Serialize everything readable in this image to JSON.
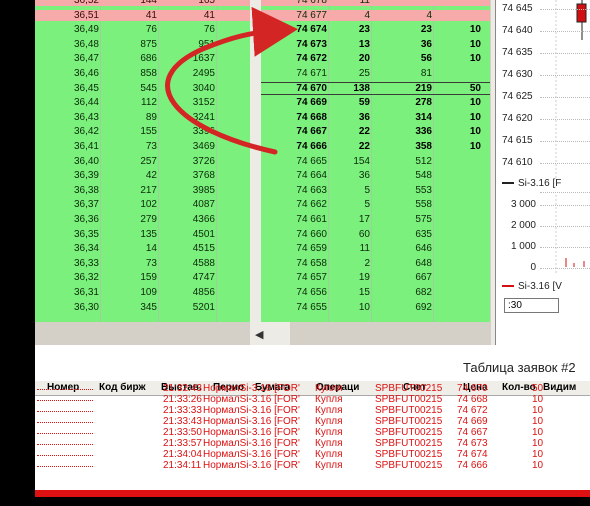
{
  "left_book": {
    "rows": [
      {
        "c0": "36,52",
        "c1": "144",
        "c2": "165",
        "color": "red"
      },
      {
        "c0": "36,51",
        "c1": "41",
        "c2": "41",
        "color": "red"
      },
      {
        "c0": "36,49",
        "c1": "76",
        "c2": "76",
        "color": "green"
      },
      {
        "c0": "36,48",
        "c1": "875",
        "c2": "951",
        "color": "green"
      },
      {
        "c0": "36,47",
        "c1": "686",
        "c2": "1637",
        "color": "green"
      },
      {
        "c0": "36,46",
        "c1": "858",
        "c2": "2495",
        "color": "green"
      },
      {
        "c0": "36,45",
        "c1": "545",
        "c2": "3040",
        "color": "green"
      },
      {
        "c0": "36,44",
        "c1": "112",
        "c2": "3152",
        "color": "green"
      },
      {
        "c0": "36,43",
        "c1": "89",
        "c2": "3241",
        "color": "green"
      },
      {
        "c0": "36,42",
        "c1": "155",
        "c2": "3396",
        "color": "green"
      },
      {
        "c0": "36,41",
        "c1": "73",
        "c2": "3469",
        "color": "green"
      },
      {
        "c0": "36,40",
        "c1": "257",
        "c2": "3726",
        "color": "green"
      },
      {
        "c0": "36,39",
        "c1": "42",
        "c2": "3768",
        "color": "green"
      },
      {
        "c0": "36,38",
        "c1": "217",
        "c2": "3985",
        "color": "green"
      },
      {
        "c0": "36,37",
        "c1": "102",
        "c2": "4087",
        "color": "green"
      },
      {
        "c0": "36,36",
        "c1": "279",
        "c2": "4366",
        "color": "green"
      },
      {
        "c0": "36,35",
        "c1": "135",
        "c2": "4501",
        "color": "green"
      },
      {
        "c0": "36,34",
        "c1": "14",
        "c2": "4515",
        "color": "green"
      },
      {
        "c0": "36,33",
        "c1": "73",
        "c2": "4588",
        "color": "green"
      },
      {
        "c0": "36,32",
        "c1": "159",
        "c2": "4747",
        "color": "green"
      },
      {
        "c0": "36,31",
        "c1": "109",
        "c2": "4856",
        "color": "green"
      },
      {
        "c0": "36,30",
        "c1": "345",
        "c2": "5201",
        "color": "green"
      }
    ]
  },
  "right_book": {
    "rows": [
      {
        "c0": "74 678",
        "c1": "11",
        "c2": "",
        "c3": "",
        "color": "red",
        "bold": false
      },
      {
        "c0": "74 677",
        "c1": "4",
        "c2": "4",
        "c3": "",
        "color": "red",
        "bold": false
      },
      {
        "c0": "74 674",
        "c1": "23",
        "c2": "23",
        "c3": "10",
        "color": "green",
        "bold": true
      },
      {
        "c0": "74 673",
        "c1": "13",
        "c2": "36",
        "c3": "10",
        "color": "green",
        "bold": true
      },
      {
        "c0": "74 672",
        "c1": "20",
        "c2": "56",
        "c3": "10",
        "color": "green",
        "bold": true
      },
      {
        "c0": "74 671",
        "c1": "25",
        "c2": "81",
        "c3": "",
        "color": "green",
        "bold": false
      },
      {
        "c0": "74 670",
        "c1": "138",
        "c2": "219",
        "c3": "50",
        "color": "green",
        "bold": true,
        "highlight": true
      },
      {
        "c0": "74 669",
        "c1": "59",
        "c2": "278",
        "c3": "10",
        "color": "green",
        "bold": true
      },
      {
        "c0": "74 668",
        "c1": "36",
        "c2": "314",
        "c3": "10",
        "color": "green",
        "bold": true
      },
      {
        "c0": "74 667",
        "c1": "22",
        "c2": "336",
        "c3": "10",
        "color": "green",
        "bold": true
      },
      {
        "c0": "74 666",
        "c1": "22",
        "c2": "358",
        "c3": "10",
        "color": "green",
        "bold": true
      },
      {
        "c0": "74 665",
        "c1": "154",
        "c2": "512",
        "c3": "",
        "color": "green",
        "bold": false
      },
      {
        "c0": "74 664",
        "c1": "36",
        "c2": "548",
        "c3": "",
        "color": "green",
        "bold": false
      },
      {
        "c0": "74 663",
        "c1": "5",
        "c2": "553",
        "c3": "",
        "color": "green",
        "bold": false
      },
      {
        "c0": "74 662",
        "c1": "5",
        "c2": "558",
        "c3": "",
        "color": "green",
        "bold": false
      },
      {
        "c0": "74 661",
        "c1": "17",
        "c2": "575",
        "c3": "",
        "color": "green",
        "bold": false
      },
      {
        "c0": "74 660",
        "c1": "60",
        "c2": "635",
        "c3": "",
        "color": "green",
        "bold": false
      },
      {
        "c0": "74 659",
        "c1": "11",
        "c2": "646",
        "c3": "",
        "color": "green",
        "bold": false
      },
      {
        "c0": "74 658",
        "c1": "2",
        "c2": "648",
        "c3": "",
        "color": "green",
        "bold": false
      },
      {
        "c0": "74 657",
        "c1": "19",
        "c2": "667",
        "c3": "",
        "color": "green",
        "bold": false
      },
      {
        "c0": "74 656",
        "c1": "15",
        "c2": "682",
        "c3": "",
        "color": "green",
        "bold": false
      },
      {
        "c0": "74 655",
        "c1": "10",
        "c2": "692",
        "c3": "",
        "color": "green",
        "bold": false
      }
    ]
  },
  "chart": {
    "price_ticks": [
      "74 645",
      "74 640",
      "74 635",
      "74 630",
      "74 625",
      "74 620",
      "74 615",
      "74 610"
    ],
    "price_legend": "Si-3.16 [F",
    "volume_ticks": [
      "3 000",
      "2 000",
      "1 000",
      "0"
    ],
    "volume_legend": "Si-3.16 [V",
    "interval_value": ":30",
    "price_line_color": "#222222",
    "volume_line_color": "#d11111"
  },
  "orders": {
    "title": "Таблица заявок #2",
    "columns": [
      "Номер",
      "Код бирж",
      "Выстав.",
      "Перио",
      "Бумага",
      "Операци",
      "Счет",
      "Цена",
      "Кол-во",
      "Видим"
    ],
    "rows": [
      {
        "time": "21:32:43",
        "security": "НормалSi-3.16 [FOR'",
        "op": "Купля",
        "account": "SPBFUT00215",
        "price": "74 670",
        "qty": "50"
      },
      {
        "time": "21:33:26",
        "security": "НормалSi-3.16 [FOR'",
        "op": "Купля",
        "account": "SPBFUT00215",
        "price": "74 668",
        "qty": "10"
      },
      {
        "time": "21:33:33",
        "security": "НормалSi-3.16 [FOR'",
        "op": "Купля",
        "account": "SPBFUT00215",
        "price": "74 672",
        "qty": "10"
      },
      {
        "time": "21:33:43",
        "security": "НормалSi-3.16 [FOR'",
        "op": "Купля",
        "account": "SPBFUT00215",
        "price": "74 669",
        "qty": "10"
      },
      {
        "time": "21:33:50",
        "security": "НормалSi-3.16 [FOR'",
        "op": "Купля",
        "account": "SPBFUT00215",
        "price": "74 667",
        "qty": "10"
      },
      {
        "time": "21:33:57",
        "security": "НормалSi-3.16 [FOR'",
        "op": "Купля",
        "account": "SPBFUT00215",
        "price": "74 673",
        "qty": "10"
      },
      {
        "time": "21:34:04",
        "security": "НормалSi-3.16 [FOR'",
        "op": "Купля",
        "account": "SPBFUT00215",
        "price": "74 674",
        "qty": "10"
      },
      {
        "time": "21:34:11",
        "security": "НормалSi-3.16 [FOR'",
        "op": "Купля",
        "account": "SPBFUT00215",
        "price": "74 666",
        "qty": "10"
      }
    ]
  },
  "colors": {
    "book_green": "#7cf07c",
    "book_red": "#f6aaaa",
    "annotation_arrow": "#d42525",
    "order_text": "#dd1111"
  }
}
